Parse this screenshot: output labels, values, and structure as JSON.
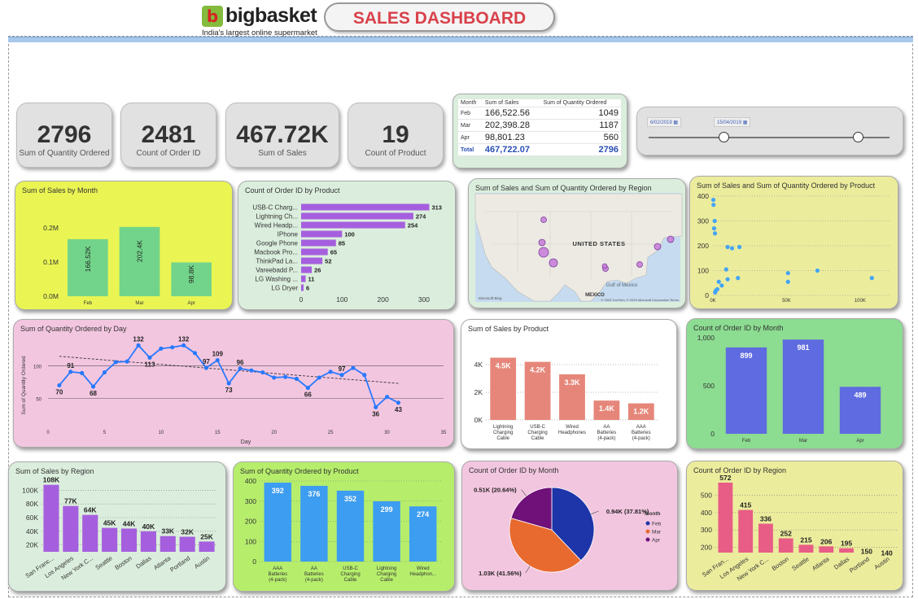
{
  "header": {
    "brand": "bigbasket",
    "logo_glyph": "b",
    "tagline": "India's largest online supermarket",
    "title": "SALES DASHBOARD"
  },
  "kpis": [
    {
      "value": "2796",
      "label": "Sum of Quantity Ordered"
    },
    {
      "value": "2481",
      "label": "Count of Order ID"
    },
    {
      "value": "467.72K",
      "label": "Sum of Sales"
    },
    {
      "value": "19",
      "label": "Count of Product"
    }
  ],
  "summary_table": {
    "headers": [
      "Month",
      "Sum of Sales",
      "Sum of Quantity Ordered"
    ],
    "rows": [
      {
        "month": "Feb",
        "sales": "166,522.56",
        "qty": "1049"
      },
      {
        "month": "Mar",
        "sales": "202,398.28",
        "qty": "1187"
      },
      {
        "month": "Apr",
        "sales": "98,801.23",
        "qty": "560"
      }
    ],
    "total": {
      "month": "Total",
      "sales": "467,722.07",
      "qty": "2796"
    }
  },
  "date_slicer": {
    "start": "6/02/2019",
    "end": "15/04/2019",
    "calendar_icon": "calendar-icon"
  },
  "map": {
    "title": "Sum of Sales and Sum of Quantity Ordered by Region",
    "country_label": "UNITED STATES",
    "labels": [
      "Gulf of Mexico",
      "MEXICO"
    ],
    "attribution": "© 2025 TomTom, © 2025 Microsoft Corporation Terms",
    "provider": "Microsoft Bing"
  },
  "chart_data": [
    {
      "id": "sales-by-month",
      "type": "bar",
      "title": "Sum of Sales by Month",
      "categories": [
        "Feb",
        "Mar",
        "Apr"
      ],
      "values": [
        166520,
        202400,
        98800
      ],
      "data_labels": [
        "166.52K",
        "202.4K",
        "98.8K"
      ],
      "yticks": [
        "0.0M",
        "0.1M",
        "0.2M"
      ],
      "ylim": [
        0,
        240000
      ],
      "color": "#72d48a"
    },
    {
      "id": "orders-by-product",
      "type": "bar",
      "orientation": "horizontal",
      "title": "Count of Order ID by Product",
      "categories": [
        "USB-C Charg...",
        "Lightning Ch...",
        "Wired Headp...",
        "IPhone",
        "Google Phone",
        "Macbook Pro...",
        "ThinkPad La...",
        "Vareebadd P...",
        "LG Washing ...",
        "LG Dryer"
      ],
      "values": [
        313,
        274,
        254,
        100,
        85,
        65,
        52,
        26,
        11,
        6
      ],
      "xticks": [
        "0",
        "100",
        "200",
        "300"
      ],
      "xlim": [
        0,
        320
      ],
      "color": "#a55fde"
    },
    {
      "id": "sales-qty-by-product",
      "type": "scatter",
      "title": "Sum of Sales and Sum of Quantity Ordered by Product",
      "x": [
        300,
        400,
        800,
        1200,
        1400,
        1500,
        2000,
        3000,
        4000,
        6000,
        9000,
        10000,
        10000,
        13000,
        17000,
        18000,
        51000,
        51000,
        71000,
        108000
      ],
      "y": [
        385,
        365,
        270,
        300,
        250,
        12,
        20,
        25,
        55,
        40,
        105,
        65,
        195,
        190,
        70,
        195,
        90,
        55,
        100,
        70
      ],
      "xticks": [
        "0K",
        "50K",
        "100K"
      ],
      "yticks": [
        "0",
        "100",
        "200",
        "300",
        "400"
      ],
      "xlim": [
        0,
        120000
      ],
      "ylim": [
        0,
        400
      ],
      "color": "#42a5f5"
    },
    {
      "id": "qty-by-day",
      "type": "line",
      "title": "Sum of Quantity Ordered by Day",
      "xlabel": "Day",
      "ylabel": "Sum of Quantity Ordered",
      "x": [
        1,
        2,
        3,
        4,
        5,
        6,
        7,
        8,
        9,
        10,
        11,
        12,
        13,
        14,
        15,
        16,
        17,
        18,
        19,
        20,
        21,
        22,
        23,
        24,
        25,
        26,
        27,
        28,
        29,
        30,
        31
      ],
      "y": [
        70,
        91,
        89,
        68,
        90,
        106,
        107,
        132,
        113,
        127,
        129,
        132,
        120,
        97,
        109,
        73,
        96,
        93,
        90,
        82,
        83,
        80,
        66,
        82,
        91,
        86,
        97,
        86,
        36,
        52,
        43
      ],
      "point_labels": {
        "1": "70",
        "2": "91",
        "4": "68",
        "8": "132",
        "9": "113",
        "12": "132",
        "14": "97",
        "15": "109",
        "16": "73",
        "17": "96",
        "23": "66",
        "26": "97",
        "29": "36",
        "31": "43"
      },
      "trend": [
        [
          1,
          115
        ],
        [
          31,
          73
        ]
      ],
      "xticks": [
        "0",
        "5",
        "10",
        "15",
        "20",
        "25",
        "30",
        "35"
      ],
      "yticks": [
        "50",
        "100"
      ],
      "xlim": [
        0,
        35
      ],
      "ylim": [
        20,
        140
      ],
      "color": "#2979ff"
    },
    {
      "id": "sales-by-product",
      "type": "bar",
      "title": "Sum of Sales by Product",
      "categories": [
        "Lightning Charging Cable",
        "USB-C Charging Cable",
        "Wired Headphones",
        "AA Batteries (4-pack)",
        "AAA Batteries (4-pack)"
      ],
      "values": [
        4500,
        4200,
        3300,
        1400,
        1200
      ],
      "data_labels": [
        "4.5K",
        "4.2K",
        "3.3K",
        "1.4K",
        "1.2K"
      ],
      "yticks": [
        "0K",
        "2K",
        "4K"
      ],
      "ylim": [
        0,
        5000
      ],
      "color": "#e6867a"
    },
    {
      "id": "orders-by-month",
      "type": "bar",
      "title": "Count of Order ID by Month",
      "categories": [
        "Feb",
        "Mar",
        "Apr"
      ],
      "values": [
        899,
        981,
        489
      ],
      "data_labels": [
        "899",
        "981",
        "489"
      ],
      "yticks": [
        "0",
        "500",
        "1,000"
      ],
      "ylim": [
        0,
        1000
      ],
      "color": "#5f6be0"
    },
    {
      "id": "sales-by-region",
      "type": "bar",
      "title": "Sum of Sales by Region",
      "categories": [
        "San Franc...",
        "Los Angeles",
        "New York C...",
        "Seattle",
        "Boston",
        "Dallas",
        "Atlanta",
        "Portland",
        "Austin"
      ],
      "values": [
        108000,
        77000,
        64000,
        45000,
        44000,
        40000,
        33000,
        32000,
        25000
      ],
      "data_labels": [
        "108K",
        "77K",
        "64K",
        "45K",
        "44K",
        "40K",
        "33K",
        "32K",
        "25K"
      ],
      "yticks": [
        "20K",
        "40K",
        "60K",
        "80K",
        "100K"
      ],
      "ylim": [
        10000,
        110000
      ],
      "color": "#a55fde"
    },
    {
      "id": "qty-by-product",
      "type": "bar",
      "title": "Sum of Quantity Ordered by Product",
      "categories": [
        "AAA Batteries (4-pack)",
        "AA Batteries (4-pack)",
        "USB-C Charging Cable",
        "Lightning Charging Cable",
        "Wired Headphon..."
      ],
      "values": [
        392,
        376,
        352,
        299,
        274
      ],
      "data_labels": [
        "392",
        "376",
        "352",
        "299",
        "274"
      ],
      "yticks": [
        "0",
        "100",
        "200",
        "300",
        "400"
      ],
      "ylim": [
        0,
        400
      ],
      "color": "#3d9df0"
    },
    {
      "id": "orders-by-month-pie",
      "type": "pie",
      "title": "Count of Order ID by Month",
      "legend_title": "Month",
      "categories": [
        "Feb",
        "Mar",
        "Apr"
      ],
      "values": [
        0.94,
        1.03,
        0.51
      ],
      "labels": [
        "0.94K (37.81%)",
        "1.03K (41.56%)",
        "0.51K (20.64%)"
      ],
      "colors": [
        "#1d35a8",
        "#e86a2f",
        "#6f1178"
      ]
    },
    {
      "id": "orders-by-region",
      "type": "bar",
      "title": "Count of Order ID by Region",
      "categories": [
        "San Fran...",
        "Los Angeles",
        "New York C...",
        "Boston",
        "Seattle",
        "Atlanta",
        "Dallas",
        "Portland",
        "Austin"
      ],
      "values": [
        572,
        415,
        336,
        252,
        215,
        206,
        195,
        150,
        140
      ],
      "data_labels": [
        "572",
        "415",
        "336",
        "252",
        "215",
        "206",
        "195",
        "150",
        "140"
      ],
      "yticks": [
        "200",
        "300",
        "400",
        "500"
      ],
      "ylim": [
        170,
        600
      ],
      "color": "#e85d86"
    }
  ]
}
